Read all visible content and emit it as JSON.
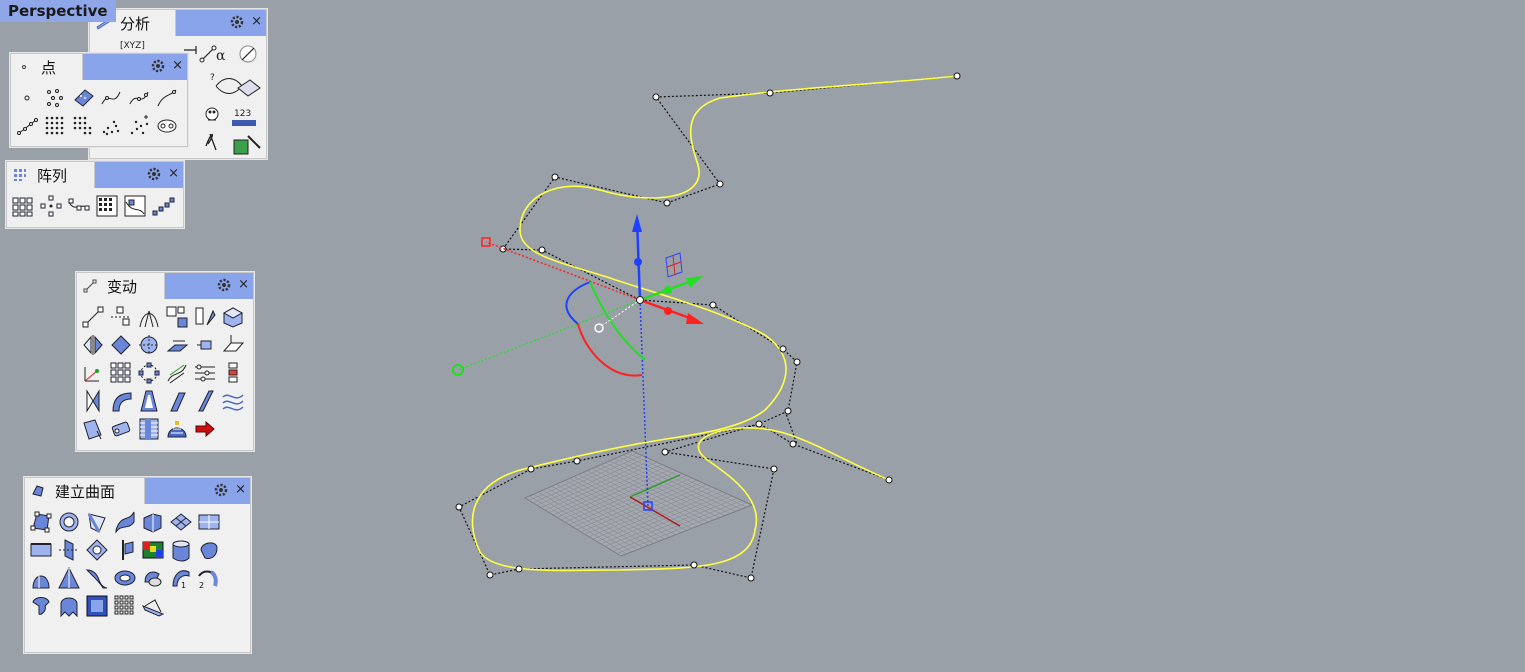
{
  "viewport": {
    "label": "Perspective"
  },
  "panels": {
    "analysis": {
      "title": "分析",
      "partial_label": "[XYZ]",
      "count_label": "123"
    },
    "point": {
      "title": "点"
    },
    "array": {
      "title": "阵列"
    },
    "transform": {
      "title": "变动"
    },
    "surface": {
      "title": "建立曲面",
      "num1": "1",
      "num2": "2"
    }
  },
  "close_glyph": "×",
  "colors": {
    "viewport_bg": "#9aa0a8",
    "panel_bg": "#f0f0f0",
    "panel_header": "#8aa4ec",
    "curve": "#ffff44",
    "gumball_x": "#ff2020",
    "gumball_y": "#20e020",
    "gumball_z": "#2040ff"
  }
}
